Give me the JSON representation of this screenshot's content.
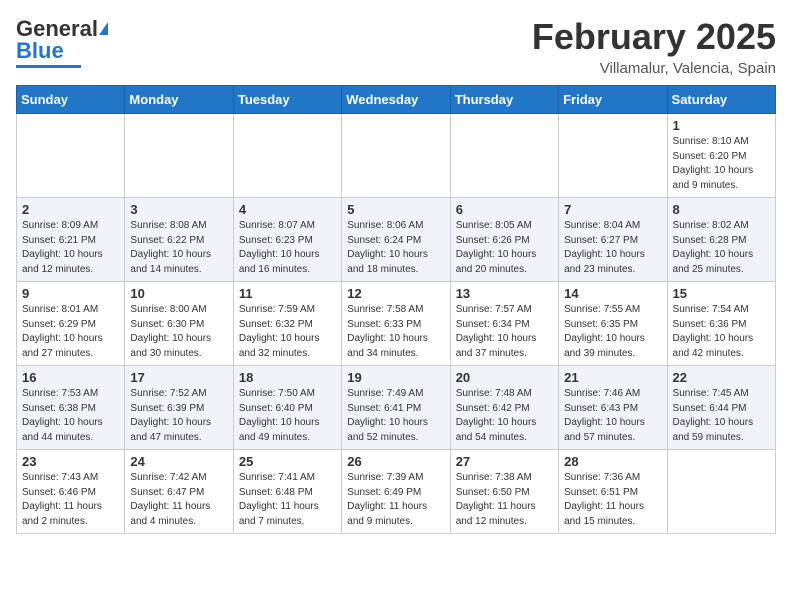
{
  "header": {
    "logo_general": "General",
    "logo_blue": "Blue",
    "month": "February 2025",
    "location": "Villamalur, Valencia, Spain"
  },
  "weekdays": [
    "Sunday",
    "Monday",
    "Tuesday",
    "Wednesday",
    "Thursday",
    "Friday",
    "Saturday"
  ],
  "weeks": [
    [
      {
        "day": "",
        "info": ""
      },
      {
        "day": "",
        "info": ""
      },
      {
        "day": "",
        "info": ""
      },
      {
        "day": "",
        "info": ""
      },
      {
        "day": "",
        "info": ""
      },
      {
        "day": "",
        "info": ""
      },
      {
        "day": "1",
        "info": "Sunrise: 8:10 AM\nSunset: 6:20 PM\nDaylight: 10 hours\nand 9 minutes."
      }
    ],
    [
      {
        "day": "2",
        "info": "Sunrise: 8:09 AM\nSunset: 6:21 PM\nDaylight: 10 hours\nand 12 minutes."
      },
      {
        "day": "3",
        "info": "Sunrise: 8:08 AM\nSunset: 6:22 PM\nDaylight: 10 hours\nand 14 minutes."
      },
      {
        "day": "4",
        "info": "Sunrise: 8:07 AM\nSunset: 6:23 PM\nDaylight: 10 hours\nand 16 minutes."
      },
      {
        "day": "5",
        "info": "Sunrise: 8:06 AM\nSunset: 6:24 PM\nDaylight: 10 hours\nand 18 minutes."
      },
      {
        "day": "6",
        "info": "Sunrise: 8:05 AM\nSunset: 6:26 PM\nDaylight: 10 hours\nand 20 minutes."
      },
      {
        "day": "7",
        "info": "Sunrise: 8:04 AM\nSunset: 6:27 PM\nDaylight: 10 hours\nand 23 minutes."
      },
      {
        "day": "8",
        "info": "Sunrise: 8:02 AM\nSunset: 6:28 PM\nDaylight: 10 hours\nand 25 minutes."
      }
    ],
    [
      {
        "day": "9",
        "info": "Sunrise: 8:01 AM\nSunset: 6:29 PM\nDaylight: 10 hours\nand 27 minutes."
      },
      {
        "day": "10",
        "info": "Sunrise: 8:00 AM\nSunset: 6:30 PM\nDaylight: 10 hours\nand 30 minutes."
      },
      {
        "day": "11",
        "info": "Sunrise: 7:59 AM\nSunset: 6:32 PM\nDaylight: 10 hours\nand 32 minutes."
      },
      {
        "day": "12",
        "info": "Sunrise: 7:58 AM\nSunset: 6:33 PM\nDaylight: 10 hours\nand 34 minutes."
      },
      {
        "day": "13",
        "info": "Sunrise: 7:57 AM\nSunset: 6:34 PM\nDaylight: 10 hours\nand 37 minutes."
      },
      {
        "day": "14",
        "info": "Sunrise: 7:55 AM\nSunset: 6:35 PM\nDaylight: 10 hours\nand 39 minutes."
      },
      {
        "day": "15",
        "info": "Sunrise: 7:54 AM\nSunset: 6:36 PM\nDaylight: 10 hours\nand 42 minutes."
      }
    ],
    [
      {
        "day": "16",
        "info": "Sunrise: 7:53 AM\nSunset: 6:38 PM\nDaylight: 10 hours\nand 44 minutes."
      },
      {
        "day": "17",
        "info": "Sunrise: 7:52 AM\nSunset: 6:39 PM\nDaylight: 10 hours\nand 47 minutes."
      },
      {
        "day": "18",
        "info": "Sunrise: 7:50 AM\nSunset: 6:40 PM\nDaylight: 10 hours\nand 49 minutes."
      },
      {
        "day": "19",
        "info": "Sunrise: 7:49 AM\nSunset: 6:41 PM\nDaylight: 10 hours\nand 52 minutes."
      },
      {
        "day": "20",
        "info": "Sunrise: 7:48 AM\nSunset: 6:42 PM\nDaylight: 10 hours\nand 54 minutes."
      },
      {
        "day": "21",
        "info": "Sunrise: 7:46 AM\nSunset: 6:43 PM\nDaylight: 10 hours\nand 57 minutes."
      },
      {
        "day": "22",
        "info": "Sunrise: 7:45 AM\nSunset: 6:44 PM\nDaylight: 10 hours\nand 59 minutes."
      }
    ],
    [
      {
        "day": "23",
        "info": "Sunrise: 7:43 AM\nSunset: 6:46 PM\nDaylight: 11 hours\nand 2 minutes."
      },
      {
        "day": "24",
        "info": "Sunrise: 7:42 AM\nSunset: 6:47 PM\nDaylight: 11 hours\nand 4 minutes."
      },
      {
        "day": "25",
        "info": "Sunrise: 7:41 AM\nSunset: 6:48 PM\nDaylight: 11 hours\nand 7 minutes."
      },
      {
        "day": "26",
        "info": "Sunrise: 7:39 AM\nSunset: 6:49 PM\nDaylight: 11 hours\nand 9 minutes."
      },
      {
        "day": "27",
        "info": "Sunrise: 7:38 AM\nSunset: 6:50 PM\nDaylight: 11 hours\nand 12 minutes."
      },
      {
        "day": "28",
        "info": "Sunrise: 7:36 AM\nSunset: 6:51 PM\nDaylight: 11 hours\nand 15 minutes."
      },
      {
        "day": "",
        "info": ""
      }
    ]
  ]
}
